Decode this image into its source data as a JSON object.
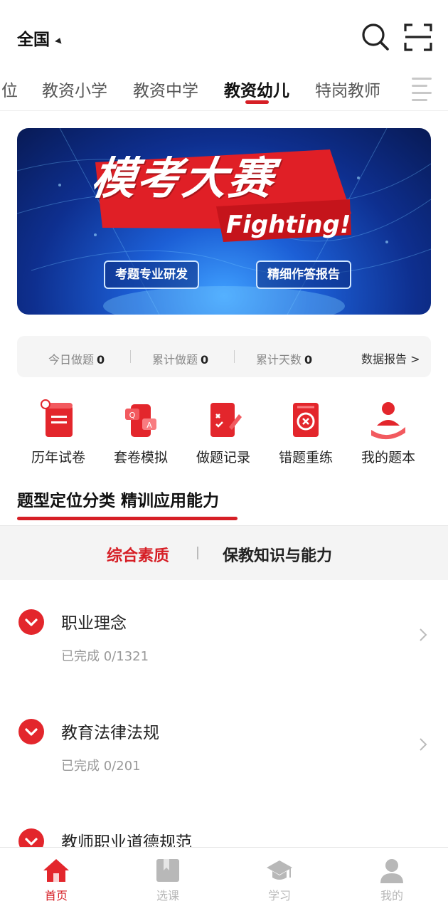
{
  "header": {
    "region": "全国"
  },
  "tabs": [
    {
      "label": "位"
    },
    {
      "label": "教资小学"
    },
    {
      "label": "教资中学"
    },
    {
      "label": "教资幼儿"
    },
    {
      "label": "特岗教师"
    }
  ],
  "banner": {
    "title": "模考大赛",
    "subtitle": "Fighting!",
    "tags": [
      "考题专业研发",
      "精细作答报告"
    ]
  },
  "stats": {
    "today_label": "今日做题",
    "today_value": "0",
    "total_label": "累计做题",
    "total_value": "0",
    "days_label": "累计天数",
    "days_value": "0",
    "report_link": "数据报告 >"
  },
  "quick_entries": [
    {
      "label": "历年试卷",
      "icon": "scroll-icon"
    },
    {
      "label": "套卷模拟",
      "icon": "qa-phone-icon"
    },
    {
      "label": "做题记录",
      "icon": "record-icon"
    },
    {
      "label": "错题重练",
      "icon": "redo-icon"
    },
    {
      "label": "我的题本",
      "icon": "person-book-icon"
    }
  ],
  "section": {
    "title": "题型定位分类 精训应用能力"
  },
  "subtabs": [
    {
      "label": "综合素质"
    },
    {
      "label": "保教知识与能力"
    }
  ],
  "list": [
    {
      "name": "职业理念",
      "progress": "已完成 0/1321"
    },
    {
      "name": "教育法律法规",
      "progress": "已完成 0/201"
    },
    {
      "name": "教师职业道德规范"
    }
  ],
  "bottom_nav": [
    {
      "label": "首页"
    },
    {
      "label": "选课"
    },
    {
      "label": "学习"
    },
    {
      "label": "我的"
    }
  ],
  "colors": {
    "accent": "#d61f26",
    "inactive_nav": "#b8b8b8"
  }
}
